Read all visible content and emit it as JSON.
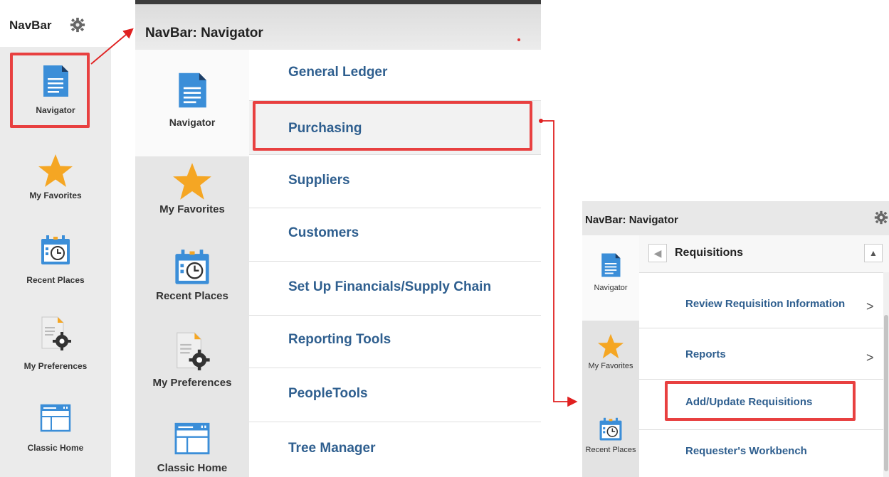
{
  "left_navbar": {
    "title": "NavBar",
    "tiles": [
      {
        "label": "Navigator",
        "icon": "document-icon"
      },
      {
        "label": "My Favorites",
        "icon": "star-icon"
      },
      {
        "label": "Recent Places",
        "icon": "calendar-clock-icon"
      },
      {
        "label": "My Preferences",
        "icon": "preferences-gear-icon"
      },
      {
        "label": "Classic Home",
        "icon": "window-icon"
      }
    ]
  },
  "navigator_panel": {
    "title": "NavBar: Navigator",
    "tiles": [
      {
        "label": "Navigator"
      },
      {
        "label": "My Favorites"
      },
      {
        "label": "Recent Places"
      },
      {
        "label": "My Preferences"
      },
      {
        "label": "Classic Home"
      }
    ],
    "menu": [
      "General Ledger",
      "Purchasing",
      "Suppliers",
      "Customers",
      "Set Up Financials/Supply Chain",
      "Reporting Tools",
      "PeopleTools",
      "Tree Manager"
    ]
  },
  "requisitions_panel": {
    "title": "NavBar: Navigator",
    "breadcrumb": "Requisitions",
    "tiles": [
      {
        "label": "Navigator"
      },
      {
        "label": "My Favorites"
      },
      {
        "label": "Recent Places"
      }
    ],
    "menu": [
      {
        "label": "Review Requisition Information",
        "chevron": ">"
      },
      {
        "label": "Reports",
        "chevron": ">"
      },
      {
        "label": "Add/Update Requisitions",
        "chevron": ""
      },
      {
        "label": "Requester's Workbench",
        "chevron": ""
      }
    ]
  },
  "colors": {
    "accent": "#2f5f8f",
    "highlight": "#e84040",
    "icon_blue": "#3b8ed8",
    "star": "#f5a623"
  }
}
